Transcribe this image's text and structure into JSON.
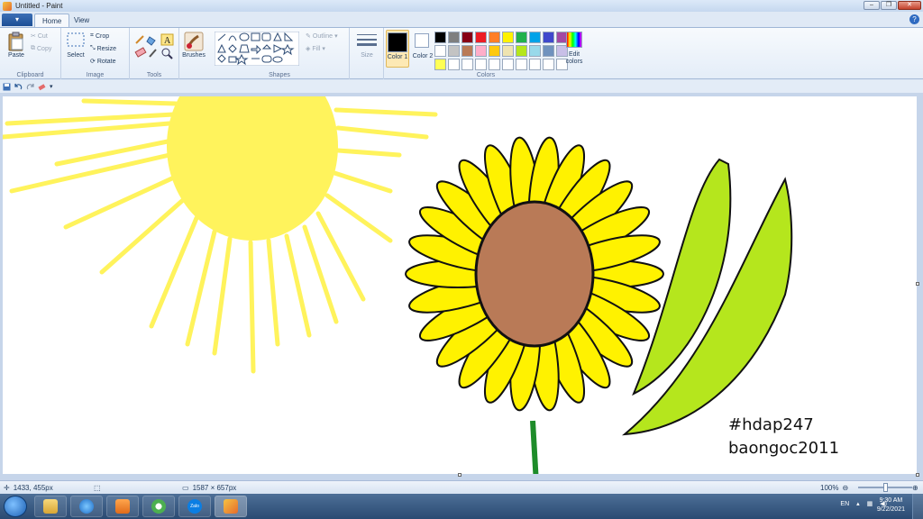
{
  "window": {
    "title": "Untitled - Paint"
  },
  "tabs": {
    "app_menu": "▾",
    "home": "Home",
    "view": "View",
    "help": "?"
  },
  "clipboard": {
    "paste": "Paste",
    "cut": "Cut",
    "copy": "Copy",
    "label": "Clipboard"
  },
  "image": {
    "select": "Select",
    "crop": "Crop",
    "resize": "Resize",
    "rotate": "Rotate",
    "label": "Image"
  },
  "tools": {
    "label": "Tools",
    "brushes": "Brushes"
  },
  "shapes": {
    "outline": "Outline",
    "fill": "Fill",
    "label": "Shapes"
  },
  "size": {
    "label": "Size"
  },
  "colors": {
    "color1": "Color 1",
    "color2": "Color 2",
    "edit": "Edit colors",
    "label": "Colors",
    "color1_value": "#000000",
    "color2_value": "#ffffff",
    "palette": [
      "#000000",
      "#7f7f7f",
      "#880015",
      "#ed1c24",
      "#ff7f27",
      "#fff200",
      "#22b14c",
      "#00a2e8",
      "#3f48cc",
      "#a349a4",
      "#ffffff",
      "#c3c3c3",
      "#b97a57",
      "#ffaec9",
      "#ffc90e",
      "#efe4b0",
      "#b5e61d",
      "#99d9ea",
      "#7092be",
      "#c8bfe7",
      "#ffff55",
      "#ffffff",
      "#ffffff",
      "#ffffff",
      "#ffffff",
      "#ffffff",
      "#ffffff",
      "#ffffff",
      "#ffffff",
      "#ffffff"
    ]
  },
  "canvas": {
    "text_line1": "#hdap247",
    "text_line2": "baongoc2011"
  },
  "status": {
    "cursor": "1433, 455px",
    "size": "1587 × 657px",
    "zoom": "100%"
  },
  "taskbar": {
    "zalo_label": "Zalo",
    "lang": "EN",
    "time": "9:30 AM",
    "date": "9/22/2021"
  }
}
